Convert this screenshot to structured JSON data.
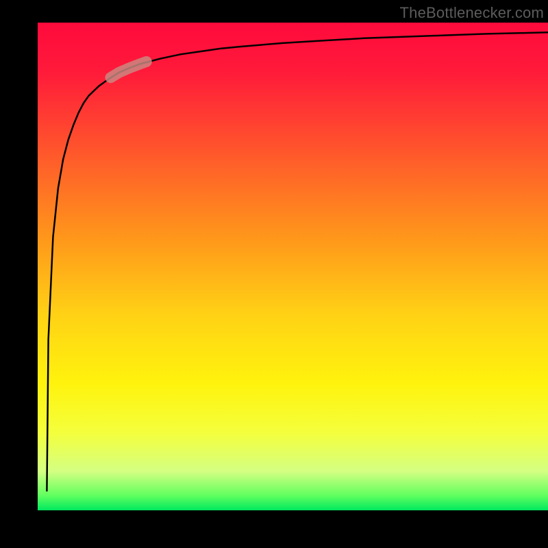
{
  "watermark": {
    "text": "TheBottlenecker.com"
  },
  "chart_data": {
    "type": "line",
    "title": "",
    "xlabel": "",
    "ylabel": "",
    "xlim": [
      0,
      1
    ],
    "ylim": [
      0,
      100
    ],
    "x": [
      0.018,
      0.021,
      0.03,
      0.04,
      0.05,
      0.06,
      0.07,
      0.08,
      0.09,
      0.1,
      0.12,
      0.14,
      0.16,
      0.18,
      0.2,
      0.24,
      0.28,
      0.32,
      0.36,
      0.4,
      0.48,
      0.56,
      0.64,
      0.72,
      0.8,
      0.88,
      0.96,
      1.0
    ],
    "y": [
      4,
      35,
      56,
      66,
      72,
      76,
      79,
      81.5,
      83.5,
      85,
      87,
      88.5,
      89.8,
      90.7,
      91.5,
      92.6,
      93.5,
      94.1,
      94.7,
      95.1,
      95.8,
      96.3,
      96.8,
      97.1,
      97.4,
      97.7,
      97.9,
      98.0
    ],
    "series": [
      {
        "name": "curve",
        "xref": "x",
        "yref": "y"
      }
    ],
    "annotations": [
      {
        "name": "highlight-segment",
        "x_range": [
          0.143,
          0.213
        ],
        "note": "thick semi-transparent pale-red marker on curve"
      }
    ],
    "background_gradient": {
      "direction": "vertical",
      "stops": [
        {
          "pos": 0,
          "color": "#ff0a3c"
        },
        {
          "pos": 28,
          "color": "#ff5c2a"
        },
        {
          "pos": 60,
          "color": "#ffd215"
        },
        {
          "pos": 84,
          "color": "#f4ff3c"
        },
        {
          "pos": 97,
          "color": "#5fff5f"
        },
        {
          "pos": 100,
          "color": "#00e85f"
        }
      ]
    }
  }
}
